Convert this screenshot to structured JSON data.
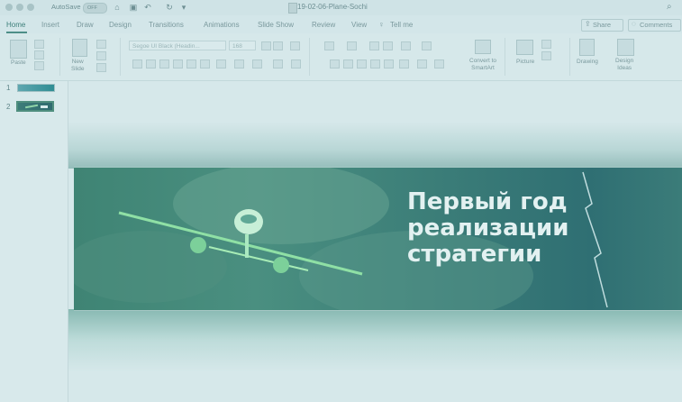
{
  "titlebar": {
    "autosave_label": "AutoSave",
    "autosave_state": "OFF",
    "document_title": "19-02-06-Plane-Sochi",
    "icons": [
      "home-icon",
      "save-icon",
      "undo-icon",
      "redo-icon",
      "more-icon",
      "search-icon"
    ]
  },
  "tabs": [
    "Home",
    "Insert",
    "Draw",
    "Design",
    "Transitions",
    "Animations",
    "Slide Show",
    "Review",
    "View"
  ],
  "active_tab": "Home",
  "tellme": "Tell me",
  "share_label": "Share",
  "comments_label": "Comments",
  "ribbon": {
    "paste_label": "Paste",
    "new_slide_label": "New\nSlide",
    "font_name": "Segoe UI Black (Headin...",
    "font_size": "168",
    "convert_label": "Convert to\nSmartArt",
    "picture_label": "Picture",
    "drawing_label": "Drawing",
    "design_ideas_label": "Design\nIdeas"
  },
  "thumbnails": [
    {
      "number": "1"
    },
    {
      "number": "2",
      "selected": true
    }
  ],
  "slide": {
    "title_lines": [
      "Первый год",
      "реализации",
      "стратегии"
    ]
  },
  "colors": {
    "accent": "#4d8f88",
    "slide_background": "#3f8474",
    "slide_text": "#e3f1f1"
  }
}
